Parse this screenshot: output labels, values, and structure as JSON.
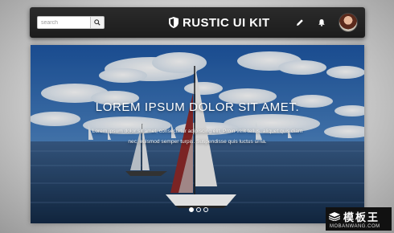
{
  "navbar": {
    "search_placeholder": "search",
    "brand_title": "RUSTIC UI KIT"
  },
  "hero": {
    "heading": "LOREM IPSUM DOLOR SIT AMET.",
    "body": "Lorem ipsum dolor sit amet, consectetur adipiscing elit. Proin velit tellus, aliquet quis diam nec, euismod semper turpis. Suspendisse quis luctus urna.",
    "slides_total": 3,
    "active_slide": 1
  },
  "watermark": {
    "name": "模板王",
    "url": "MOBANWANG.COM"
  },
  "colors": {
    "navbar_bg": "#222222",
    "sky": "#2a63a8",
    "sea": "#1f3d63"
  }
}
